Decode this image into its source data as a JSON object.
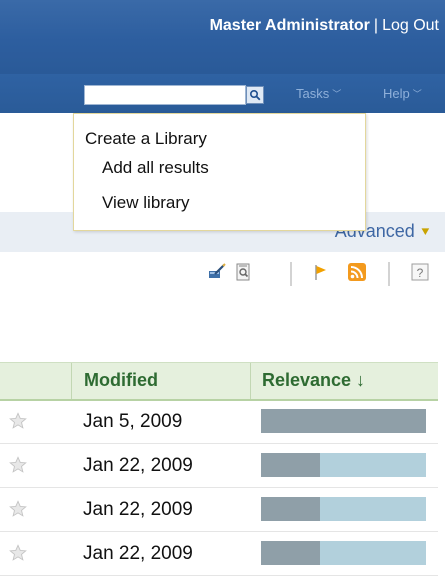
{
  "header": {
    "user_name": "Master Administrator",
    "separator": "|",
    "logout_label": "Log Out"
  },
  "nav": {
    "search_value": "",
    "tasks_label": "Tasks",
    "help_label": "Help"
  },
  "dropdown": {
    "heading": "Create a Library",
    "items": [
      "Add all results",
      "View library"
    ]
  },
  "advanced": {
    "label": "Advanced",
    "chevron": "»"
  },
  "toolbar": {
    "icons": [
      "edit-icon",
      "preview-icon",
      "flag-icon",
      "rss-icon",
      "help-icon"
    ]
  },
  "table": {
    "columns": [
      "Modified",
      "Relevance ↓"
    ],
    "rows": [
      {
        "date": "Jan 5, 2009",
        "relevance": 1.0
      },
      {
        "date": "Jan 22, 2009",
        "relevance": 0.36
      },
      {
        "date": "Jan 22, 2009",
        "relevance": 0.36
      },
      {
        "date": "Jan 22, 2009",
        "relevance": 0.36
      }
    ]
  },
  "colors": {
    "header_blue": "#2d5e9f",
    "table_header_bg": "#e5f0dd",
    "relevance_fill": "#8f9fa8",
    "relevance_track": "#b2d0dc"
  }
}
